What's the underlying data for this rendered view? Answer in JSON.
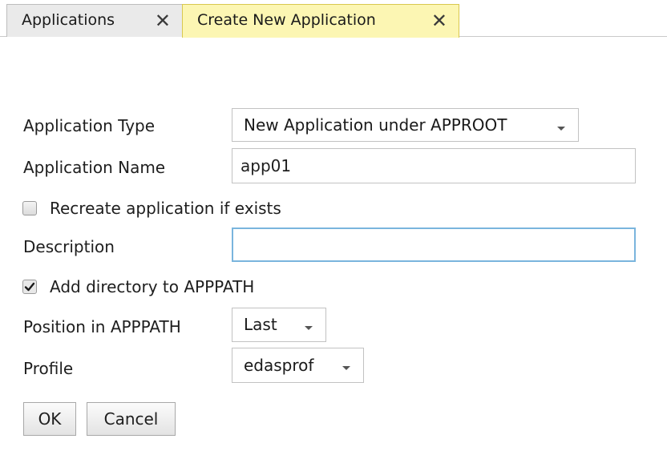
{
  "tabs": [
    {
      "label": "Applications",
      "active": false
    },
    {
      "label": "Create New Application",
      "active": true
    }
  ],
  "form": {
    "application_type": {
      "label": "Application Type",
      "value": "New Application under APPROOT"
    },
    "application_name": {
      "label": "Application Name",
      "value": "app01"
    },
    "recreate": {
      "label": "Recreate application if exists",
      "checked": false
    },
    "description": {
      "label": "Description",
      "value": ""
    },
    "add_directory": {
      "label": "Add directory to APPPATH",
      "checked": true
    },
    "position": {
      "label": "Position in APPPATH",
      "value": "Last"
    },
    "profile": {
      "label": "Profile",
      "value": "edasprof"
    }
  },
  "buttons": {
    "ok": "OK",
    "cancel": "Cancel"
  },
  "colors": {
    "active_tab_bg": "#fcf6b3",
    "inactive_tab_bg": "#eaeaea",
    "focus_border": "#7ab5dd"
  }
}
